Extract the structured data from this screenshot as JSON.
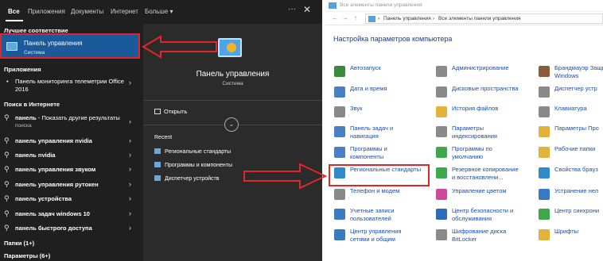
{
  "search": {
    "tabs": [
      "Все",
      "Приложения",
      "Документы",
      "Интернет",
      "Больше"
    ],
    "more_suffix": "▾",
    "dots": "···",
    "close": "✕",
    "best_match_header": "Лучшее соответствие",
    "best_match": {
      "title": "Панель управления",
      "subtitle": "Система"
    },
    "apps_header": "Приложения",
    "apps": [
      {
        "label": "Панель мониторинга телеметрии Office 2016"
      }
    ],
    "web_header": "Поиск в Интернете",
    "web": [
      {
        "bold": "панель",
        "rest": " - Показать другие результаты",
        "sub": "поиска"
      },
      {
        "bold": "панель управления nvidia",
        "rest": "",
        "sub": ""
      },
      {
        "bold": "панель nvidia",
        "rest": "",
        "sub": ""
      },
      {
        "bold": "панель управления звуком",
        "rest": "",
        "sub": ""
      },
      {
        "bold": "панель управления рутокен",
        "rest": "",
        "sub": ""
      },
      {
        "bold": "панель устройства",
        "rest": "",
        "sub": ""
      },
      {
        "bold": "панель задач windows 10",
        "rest": "",
        "sub": ""
      },
      {
        "bold": "панель быстрого доступа",
        "rest": "",
        "sub": ""
      }
    ],
    "folders_header": "Папки (1+)",
    "settings_header": "Параметры (6+)",
    "preview": {
      "title": "Панель управления",
      "subtitle": "Система",
      "open_label": "Открыть",
      "expand": "⌄",
      "recent_header": "Recent",
      "recent": [
        "Региональные стандарты",
        "Программы и компоненты",
        "Диспетчер устройств"
      ]
    }
  },
  "control_panel": {
    "window_title": "Все элементы панели управления",
    "nav": [
      "←",
      "→",
      "↑"
    ],
    "crumbs": [
      "Панель управления",
      "Все элементы панели управления"
    ],
    "crumb_sep": "›",
    "heading": "Настройка параметров компьютера",
    "columns": [
      [
        {
          "label": "Автозапуск",
          "color": "#3c8a3c"
        },
        {
          "label": "Дата и время",
          "color": "#4a7fc4"
        },
        {
          "label": "Звук",
          "color": "#8a8a8a"
        },
        {
          "label": "Панель задач и\nнавигация",
          "color": "#4a7fc4"
        },
        {
          "label": "Программы и\nкомпоненты",
          "color": "#4a7fc4"
        },
        {
          "label": "Региональные стандарты",
          "color": "#2f8acc"
        },
        {
          "label": "Телефон и модем",
          "color": "#8a8a8a"
        },
        {
          "label": "Учетные записи\nпользователей",
          "color": "#3d7ac4"
        },
        {
          "label": "Центр управления\nсетями и общим",
          "color": "#3a7ac0"
        }
      ],
      [
        {
          "label": "Администрирование",
          "color": "#8a8a8a"
        },
        {
          "label": "Дисковые пространства",
          "color": "#8a8a8a"
        },
        {
          "label": "История файлов",
          "color": "#e2b23a"
        },
        {
          "label": "Параметры\nиндексирования",
          "color": "#8a8a8a"
        },
        {
          "label": "Программы по\nумолчанию",
          "color": "#3fa84a"
        },
        {
          "label": "Резервное копирование\nи восстановлени...",
          "color": "#3fa84a"
        },
        {
          "label": "Управление цветом",
          "color": "#d04a9a"
        },
        {
          "label": "Центр безопасности и\nобслуживания",
          "color": "#2f6bb8"
        },
        {
          "label": "Шифрование диска\nBitLocker",
          "color": "#8a8a8a"
        }
      ],
      [
        {
          "label": "Брандмауэр Защи\nWindows",
          "color": "#8a5a3a"
        },
        {
          "label": "Диспетчер устр",
          "color": "#8a8a8a"
        },
        {
          "label": "Клавиатура",
          "color": "#8a8a8a"
        },
        {
          "label": "Параметры Про",
          "color": "#e2b23a"
        },
        {
          "label": "Рабочие папки",
          "color": "#e2b23a"
        },
        {
          "label": "Свойства брауз",
          "color": "#2f8acc"
        },
        {
          "label": "Устранение нел",
          "color": "#3a7ac0"
        },
        {
          "label": "Центр синхрони",
          "color": "#3fa84a"
        },
        {
          "label": "Шрифты",
          "color": "#e2b23a"
        }
      ]
    ]
  }
}
